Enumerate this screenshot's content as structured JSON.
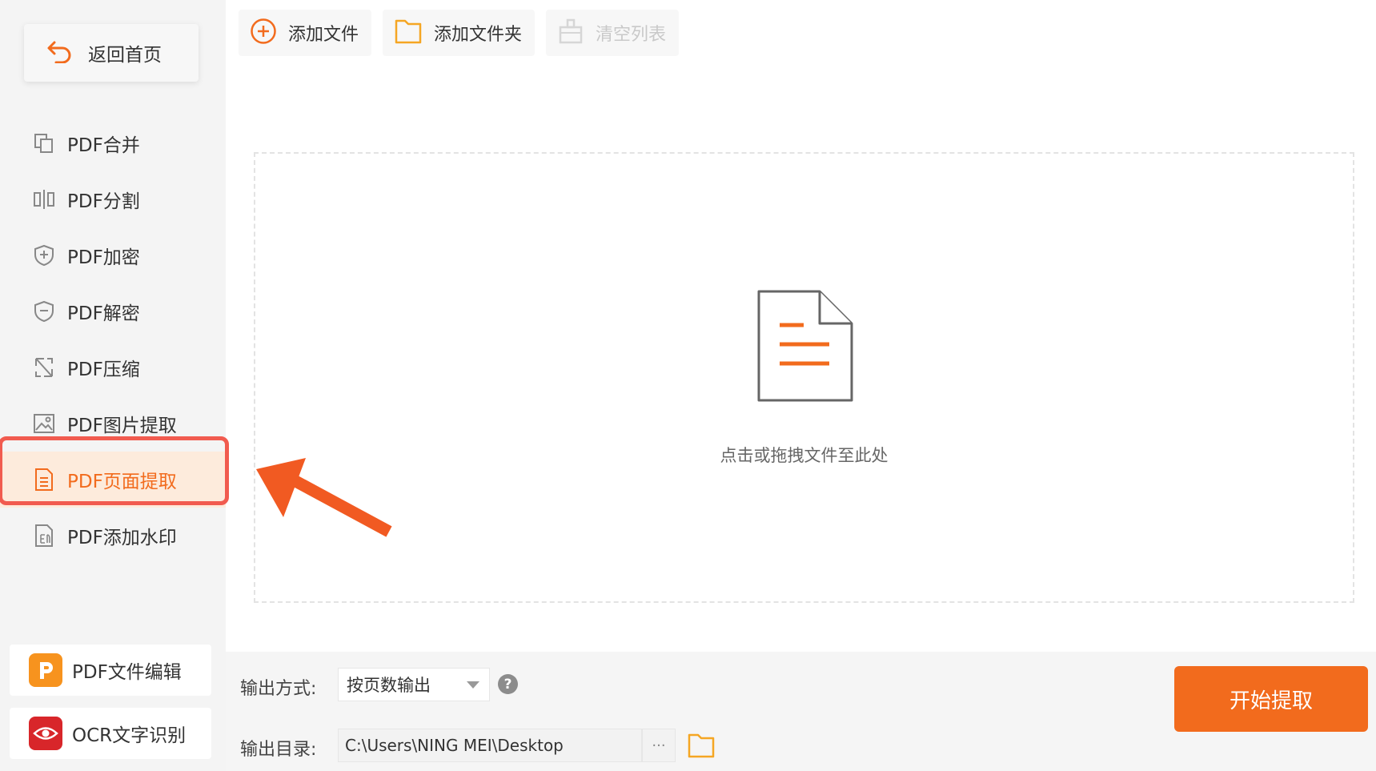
{
  "sidebar": {
    "back_label": "返回首页",
    "items": [
      {
        "label": "PDF合并",
        "icon": "merge-icon"
      },
      {
        "label": "PDF分割",
        "icon": "split-icon"
      },
      {
        "label": "PDF加密",
        "icon": "shield-plus-icon"
      },
      {
        "label": "PDF解密",
        "icon": "shield-minus-icon"
      },
      {
        "label": "PDF压缩",
        "icon": "compress-icon"
      },
      {
        "label": "PDF图片提取",
        "icon": "image-icon"
      },
      {
        "label": "PDF页面提取",
        "icon": "page-icon",
        "active": true
      },
      {
        "label": "PDF添加水印",
        "icon": "watermark-icon"
      }
    ],
    "apps": [
      {
        "label": "PDF文件编辑",
        "icon": "pdf-editor-icon",
        "color": "#f7931e"
      },
      {
        "label": "OCR文字识别",
        "icon": "ocr-eye-icon",
        "color": "#d8262a"
      }
    ]
  },
  "toolbar": {
    "add_file": "添加文件",
    "add_folder": "添加文件夹",
    "clear_list": "清空列表"
  },
  "dropzone": {
    "hint": "点击或拖拽文件至此处"
  },
  "output": {
    "mode_label": "输出方式:",
    "mode_value": "按页数输出",
    "dir_label": "输出目录:",
    "dir_value": "C:\\Users\\NING MEI\\Desktop",
    "browse_label": "···",
    "help_label": "?"
  },
  "start_button": "开始提取",
  "colors": {
    "accent": "#f26b1d",
    "highlight": "#f15b4f",
    "sidebar_bg": "#f4f4f4"
  }
}
